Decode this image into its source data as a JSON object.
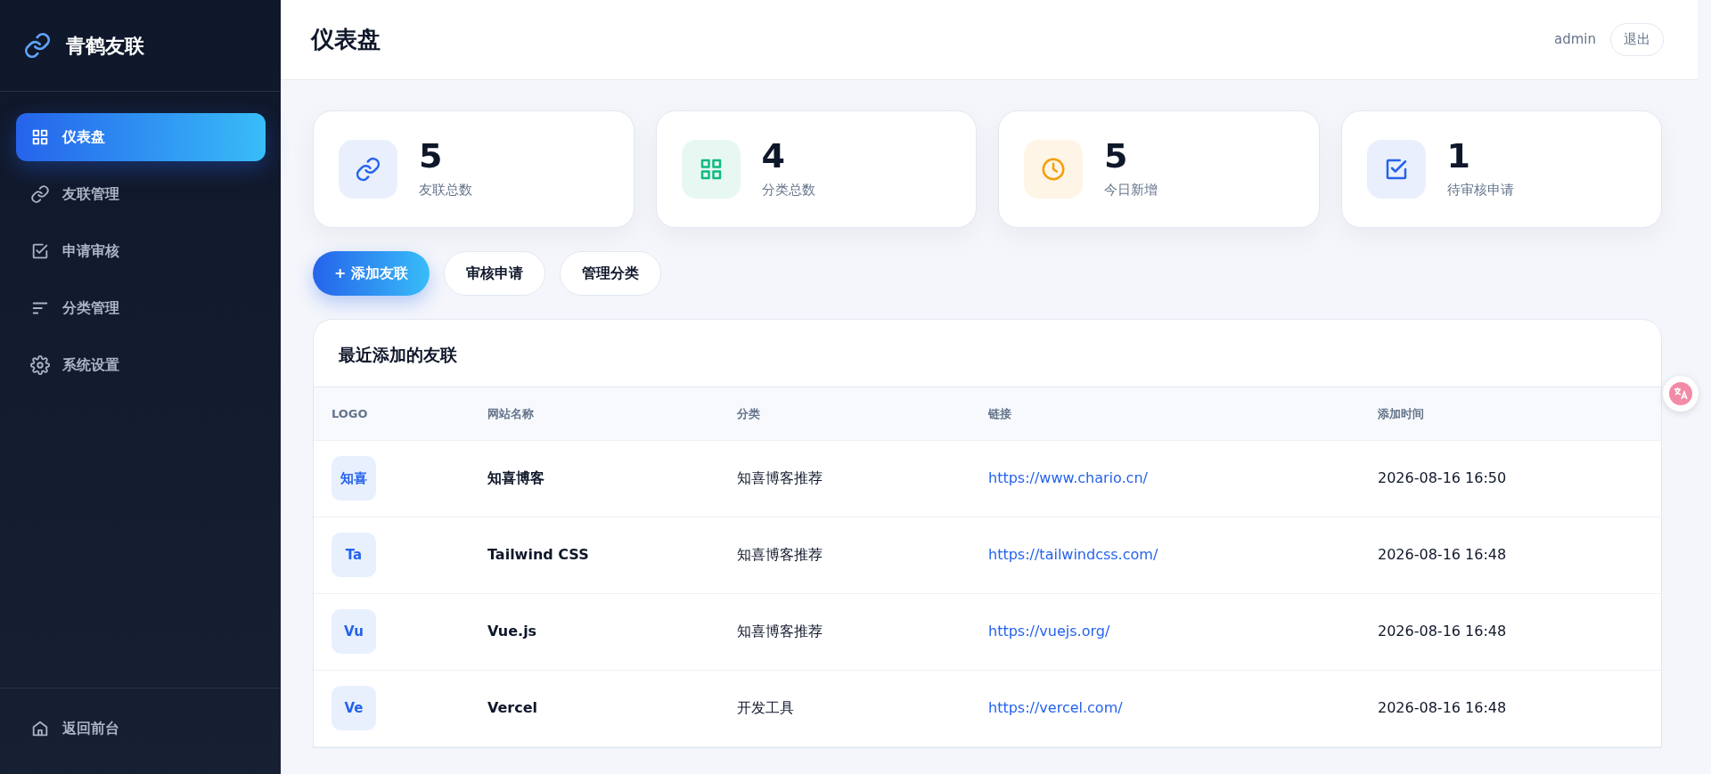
{
  "brand": {
    "title": "青鹤友联"
  },
  "sidebar": {
    "items": [
      {
        "label": "仪表盘",
        "kind": "grid",
        "selected": true
      },
      {
        "label": "友联管理",
        "kind": "link",
        "selected": false
      },
      {
        "label": "申请审核",
        "kind": "check",
        "selected": false
      },
      {
        "label": "分类管理",
        "kind": "sort",
        "selected": false
      },
      {
        "label": "系统设置",
        "kind": "gear",
        "selected": false
      }
    ],
    "footer": {
      "label": "返回前台",
      "kind": "home"
    }
  },
  "header": {
    "title": "仪表盘",
    "user": "admin",
    "logout": "退出"
  },
  "stats": [
    {
      "value": "5",
      "label": "友联总数",
      "kind": "link",
      "color": "#2563eb"
    },
    {
      "value": "4",
      "label": "分类总数",
      "kind": "grid",
      "color": "#10b981"
    },
    {
      "value": "5",
      "label": "今日新增",
      "kind": "clock",
      "color": "#f59e0b"
    },
    {
      "value": "1",
      "label": "待审核申请",
      "kind": "check",
      "color": "#2563eb"
    }
  ],
  "actions": [
    {
      "label": "+ 添加友联",
      "kind": "primary"
    },
    {
      "label": "审核申请",
      "kind": "outline"
    },
    {
      "label": "管理分类",
      "kind": "outline"
    }
  ],
  "table": {
    "title": "最近添加的友联",
    "columns": [
      "LOGO",
      "网站名称",
      "分类",
      "链接",
      "添加时间"
    ],
    "rows": [
      {
        "logo": "知喜",
        "name": "知喜博客",
        "category": "知喜博客推荐",
        "url": "https://www.chario.cn/",
        "time": "2026-08-16 16:50"
      },
      {
        "logo": "Ta",
        "name": "Tailwind CSS",
        "category": "知喜博客推荐",
        "url": "https://tailwindcss.com/",
        "time": "2026-08-16 16:48"
      },
      {
        "logo": "Vu",
        "name": "Vue.js",
        "category": "知喜博客推荐",
        "url": "https://vuejs.org/",
        "time": "2026-08-16 16:48"
      },
      {
        "logo": "Ve",
        "name": "Vercel",
        "category": "开发工具",
        "url": "https://vercel.com/",
        "time": "2026-08-16 16:48"
      }
    ]
  }
}
